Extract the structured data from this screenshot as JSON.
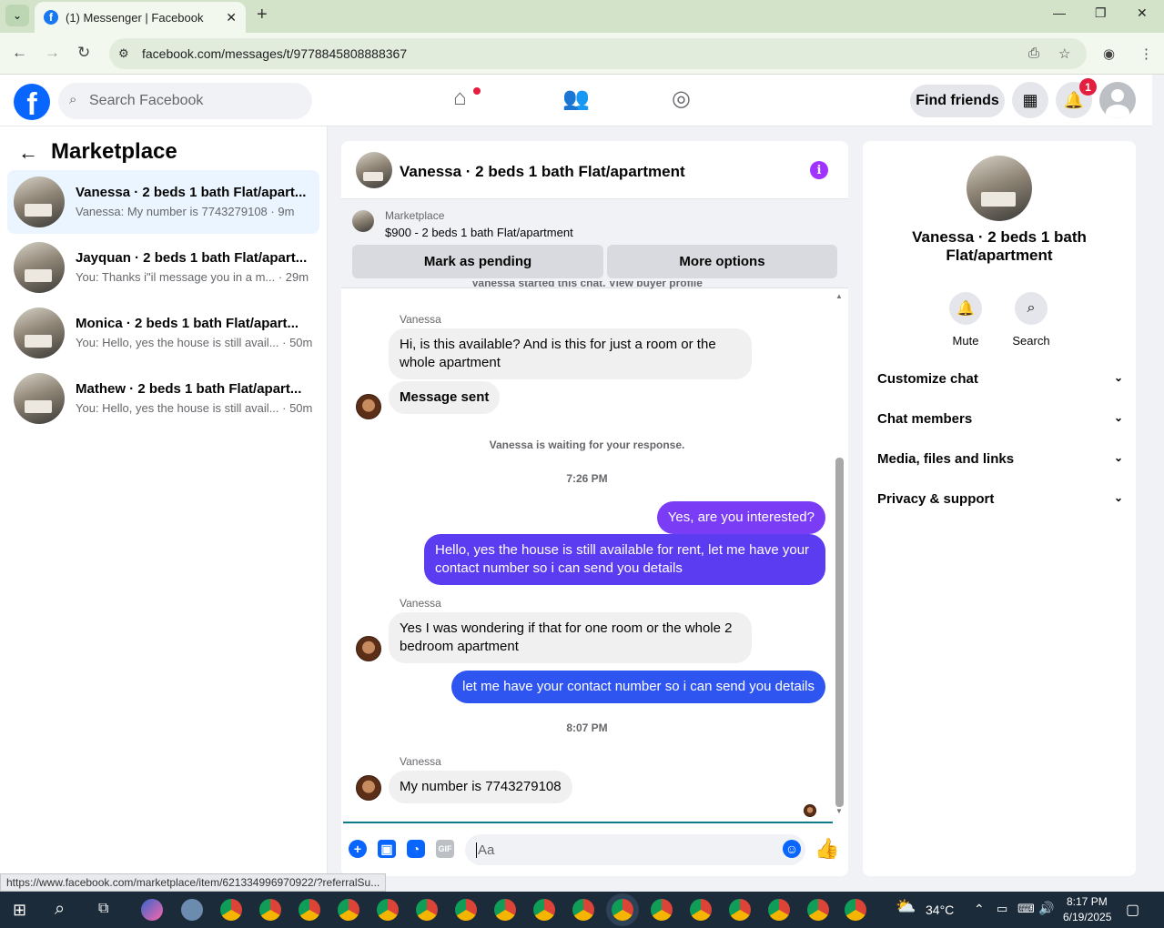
{
  "browser": {
    "tab_title": "(1) Messenger | Facebook",
    "url": "facebook.com/messages/t/9778845808888367",
    "status_url": "https://www.facebook.com/marketplace/item/621334996970922/?referralSu..."
  },
  "fb_header": {
    "search_placeholder": "Search Facebook",
    "find_friends": "Find friends",
    "notification_count": "1"
  },
  "sidebar": {
    "title": "Marketplace",
    "conversations": [
      {
        "name": "Vanessa · 2 beds 1 bath Flat/apart...",
        "preview": "Vanessa: My number is 7743279108 · 9m"
      },
      {
        "name": "Jayquan · 2 beds 1 bath Flat/apart...",
        "preview": "You: Thanks i\"il message you in a m... · 29m"
      },
      {
        "name": "Monica · 2 beds 1 bath Flat/apart...",
        "preview": "You: Hello, yes the house is still avail... · 50m"
      },
      {
        "name": "Mathew · 2 beds 1 bath Flat/apart...",
        "preview": "You: Hello, yes the house is still avail... · 50m"
      }
    ]
  },
  "chat": {
    "title": "Vanessa · 2 beds 1 bath Flat/apartment",
    "marketplace_label": "Marketplace",
    "listing": "$900 - 2 beds 1 bath Flat/apartment",
    "mark_pending": "Mark as pending",
    "more_options": "More options",
    "started_note": "Vanessa started this chat. View buyer profile",
    "sender_name": "Vanessa",
    "msg1": "Hi, is this available? And is this for just a room or the whole apartment",
    "msg2": "Message sent",
    "waiting": "Vanessa is waiting for your response.",
    "time1": "7:26 PM",
    "out1": "Yes, are you interested?",
    "out2": "Hello, yes the house is still available for rent, let me have your contact number so i can send you details",
    "msg3": "Yes I was wondering if that for one room or the whole 2 bedroom apartment",
    "out3": "let me have your contact number so i can send you details",
    "time2": "8:07 PM",
    "msg4": "My number is 7743279108",
    "composer_placeholder": "Aa",
    "gif_label": "GIF"
  },
  "right_panel": {
    "name": "Vanessa · 2 beds 1 bath Flat/apartment",
    "mute": "Mute",
    "search": "Search",
    "rows": [
      "Customize chat",
      "Chat members",
      "Media, files and links",
      "Privacy & support"
    ]
  },
  "taskbar": {
    "temperature": "34°C",
    "time": "8:17 PM",
    "date": "6/19/2025"
  },
  "colors": {
    "outgoing_purple": "#7b3cf5",
    "outgoing_blue": "#2f55f0",
    "fb_blue": "#0866ff"
  }
}
